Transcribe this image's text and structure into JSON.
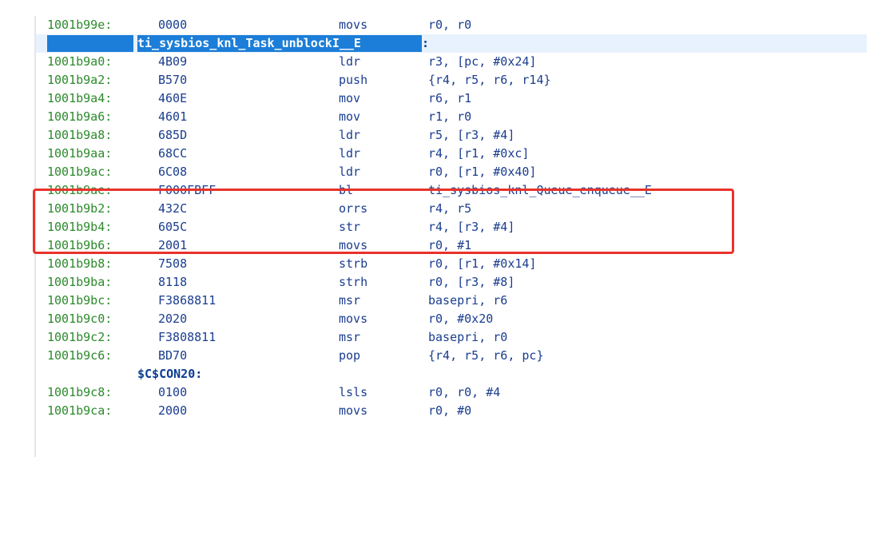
{
  "listing": {
    "rows": [
      {
        "kind": "instr",
        "addr": "1001b99e:",
        "opcode": "0000",
        "mnem": "movs",
        "operands": "r0, r0"
      },
      {
        "kind": "label",
        "text": "ti_sysbios_knl_Task_unblockI__E",
        "suffix": ":"
      },
      {
        "kind": "instr",
        "addr": "1001b9a0:",
        "opcode": "4B09",
        "mnem": "ldr",
        "operands": "r3, [pc, #0x24]"
      },
      {
        "kind": "instr",
        "addr": "1001b9a2:",
        "opcode": "B570",
        "mnem": "push",
        "operands": "{r4, r5, r6, r14}"
      },
      {
        "kind": "instr",
        "addr": "1001b9a4:",
        "opcode": "460E",
        "mnem": "mov",
        "operands": "r6, r1"
      },
      {
        "kind": "instr",
        "addr": "1001b9a6:",
        "opcode": "4601",
        "mnem": "mov",
        "operands": "r1, r0"
      },
      {
        "kind": "instr",
        "addr": "1001b9a8:",
        "opcode": "685D",
        "mnem": "ldr",
        "operands": "r5, [r3, #4]"
      },
      {
        "kind": "instr",
        "addr": "1001b9aa:",
        "opcode": "68CC",
        "mnem": "ldr",
        "operands": "r4, [r1, #0xc]"
      },
      {
        "kind": "instr",
        "addr": "1001b9ac:",
        "opcode": "6C08",
        "mnem": "ldr",
        "operands": "r0, [r1, #0x40]"
      },
      {
        "kind": "instr",
        "addr": "1001b9ae:",
        "opcode": "F000FBFF",
        "mnem": "bl",
        "operands": "ti_sysbios_knl_Queue_enqueue__E"
      },
      {
        "kind": "instr",
        "addr": "1001b9b2:",
        "opcode": "432C",
        "mnem": "orrs",
        "operands": "r4, r5"
      },
      {
        "kind": "instr",
        "addr": "1001b9b4:",
        "opcode": "605C",
        "mnem": "str",
        "operands": "r4, [r3, #4]"
      },
      {
        "kind": "instr",
        "addr": "1001b9b6:",
        "opcode": "2001",
        "mnem": "movs",
        "operands": "r0, #1"
      },
      {
        "kind": "instr",
        "addr": "1001b9b8:",
        "opcode": "7508",
        "mnem": "strb",
        "operands": "r0, [r1, #0x14]"
      },
      {
        "kind": "instr",
        "addr": "1001b9ba:",
        "opcode": "8118",
        "mnem": "strh",
        "operands": "r0, [r3, #8]"
      },
      {
        "kind": "instr",
        "addr": "1001b9bc:",
        "opcode": "F3868811",
        "mnem": "msr",
        "operands": "basepri, r6"
      },
      {
        "kind": "instr",
        "addr": "1001b9c0:",
        "opcode": "2020",
        "mnem": "movs",
        "operands": "r0, #0x20"
      },
      {
        "kind": "instr",
        "addr": "1001b9c2:",
        "opcode": "F3808811",
        "mnem": "msr",
        "operands": "basepri, r0"
      },
      {
        "kind": "instr",
        "addr": "1001b9c6:",
        "opcode": "BD70",
        "mnem": "pop",
        "operands": "{r4, r5, r6, pc}"
      },
      {
        "kind": "label2",
        "text": "$C$CON20:"
      },
      {
        "kind": "instr",
        "addr": "1001b9c8:",
        "opcode": "0100",
        "mnem": "lsls",
        "operands": "r0, r0, #4"
      },
      {
        "kind": "instr",
        "addr": "1001b9ca:",
        "opcode": "2000",
        "mnem": "movs",
        "operands": "r0, #0"
      }
    ]
  },
  "colors": {
    "address": "#2c8a2c",
    "code": "#1a3d8f",
    "selection": "#1c7ed8",
    "annotation": "#e8332b"
  }
}
